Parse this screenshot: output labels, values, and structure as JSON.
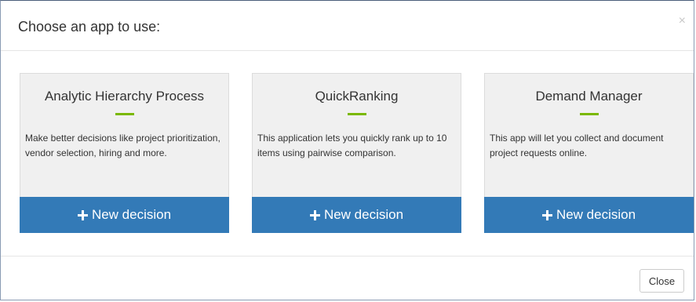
{
  "modal": {
    "title": "Choose an app to use:",
    "close_symbol": "×"
  },
  "cards": [
    {
      "title": "Analytic Hierarchy Process",
      "description": "Make better decisions like project prioritization, vendor selection, hiring and more.",
      "button_label": "New decision",
      "button_icon": "plus-icon"
    },
    {
      "title": "QuickRanking",
      "description": "This application lets you quickly rank up to 10 items using pairwise comparison.",
      "button_label": "New decision",
      "button_icon": "plus-icon"
    },
    {
      "title": "Demand Manager",
      "description": "This app will let you collect and document project requests online.",
      "button_label": "New decision",
      "button_icon": "plus-icon"
    }
  ],
  "footer": {
    "close_label": "Close"
  },
  "colors": {
    "accent_blue": "#337ab7",
    "divider_green": "#7ab800",
    "card_background": "#f0f0f0"
  }
}
